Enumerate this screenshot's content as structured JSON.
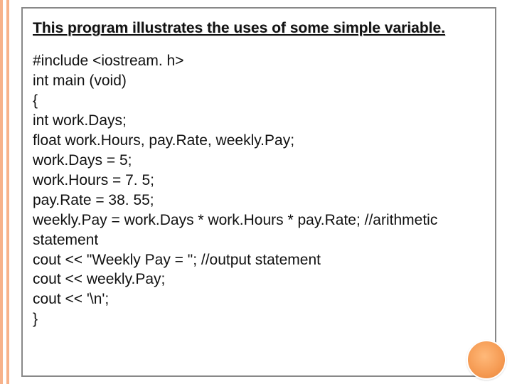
{
  "title": "This program illustrates the uses of some simple variable.",
  "code": {
    "l1": "#include <iostream. h>",
    "l2": "int main (void)",
    "l3": "{",
    "l4": "int work.Days;",
    "l5": "float work.Hours, pay.Rate, weekly.Pay;",
    "l6": "work.Days = 5;",
    "l7": "work.Hours = 7. 5;",
    "l8": "pay.Rate = 38. 55;",
    "l9": "weekly.Pay = work.Days * work.Hours * pay.Rate;  //arithmetic statement",
    "l10": "cout << \"Weekly Pay = \";    //output statement",
    "l11": "cout << weekly.Pay;",
    "l12": "cout << '\\n';",
    "l13": "}"
  }
}
